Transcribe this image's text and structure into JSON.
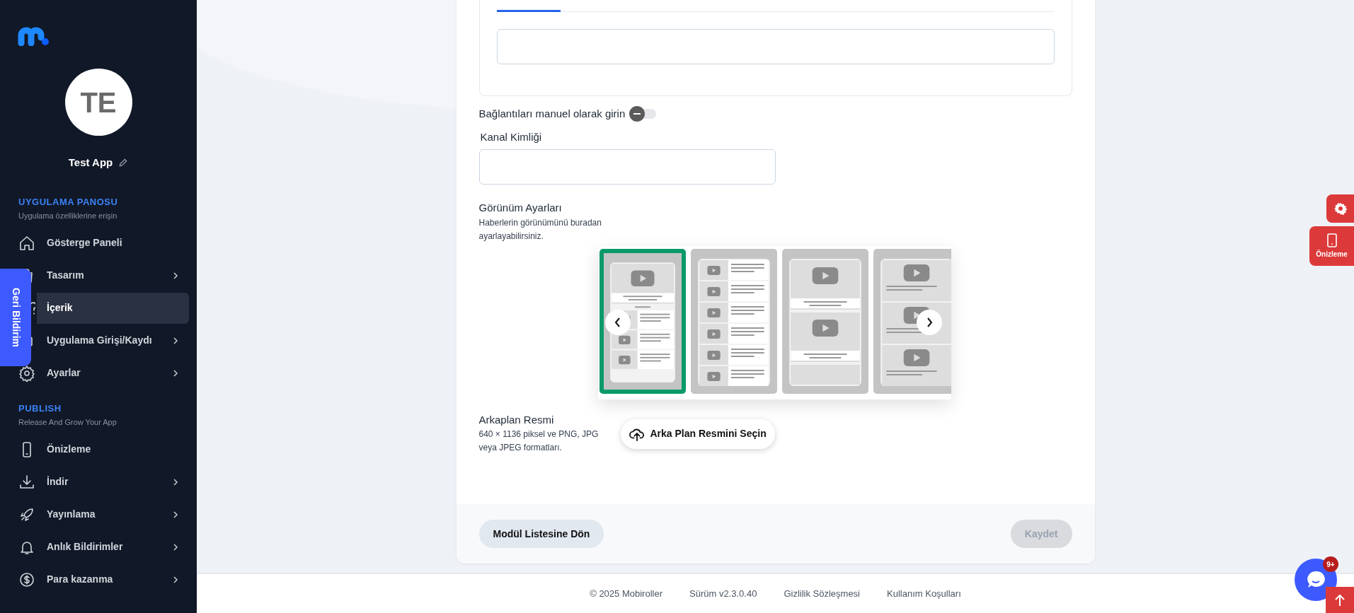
{
  "sidebar": {
    "avatar_initials": "TE",
    "app_name": "Test App",
    "sections": [
      {
        "title": "UYGULAMA PANOSU",
        "subtitle": "Uygulama özelliklerine erişin",
        "items": [
          {
            "label": "Gösterge Paneli",
            "selected": false,
            "expandable": false
          },
          {
            "label": "Tasarım",
            "selected": false,
            "expandable": true
          },
          {
            "label": "İçerik",
            "selected": true,
            "expandable": false
          },
          {
            "label": "Uygulama Girişi/Kaydı",
            "selected": false,
            "expandable": true
          },
          {
            "label": "Ayarlar",
            "selected": false,
            "expandable": true
          }
        ]
      },
      {
        "title": "PUBLISH",
        "subtitle": "Release And Grow Your App",
        "items": [
          {
            "label": "Önizleme",
            "selected": false,
            "expandable": false
          },
          {
            "label": "İndir",
            "selected": false,
            "expandable": true
          },
          {
            "label": "Yayınlama",
            "selected": false,
            "expandable": true
          },
          {
            "label": "Anlık Bildirimler",
            "selected": false,
            "expandable": true
          },
          {
            "label": "Para kazanma",
            "selected": false,
            "expandable": true
          }
        ]
      }
    ]
  },
  "feedback_tab": {
    "label": "Geri Bildirim"
  },
  "form": {
    "tabs": [
      {
        "selected": true
      }
    ],
    "manual_links_toggle": {
      "label": "Bağlantıları manuel olarak girin",
      "on": false
    },
    "channel_id": {
      "label": "Kanal Kimliği"
    },
    "view_settings": {
      "title": "Görünüm Ayarları",
      "description": "Haberlerin görünümünü buradan ayarlayabilirsiniz.",
      "layouts": [
        {
          "kind": "slider-list",
          "selected": true
        },
        {
          "kind": "list",
          "selected": false
        },
        {
          "kind": "cards",
          "selected": false
        },
        {
          "kind": "card-list",
          "selected": false
        }
      ]
    },
    "background_image": {
      "title": "Arkaplan Resmi",
      "description": "640 × 1136 piksel ve PNG, JPG veya JPEG formatları.",
      "button": "Arka Plan Resmini Seçin"
    },
    "back_button": "Modül Listesine Dön",
    "save_button": {
      "label": "Kaydet",
      "disabled": true
    }
  },
  "floating": {
    "preview_button": {
      "label": "Önizleme"
    },
    "chat": {
      "badge": "9+"
    }
  },
  "footer": [
    "© 2025 Mobiroller",
    "Sürüm v2.3.0.40",
    "Gizlilik Sözleşmesi",
    "Kullanım Koşulları"
  ]
}
